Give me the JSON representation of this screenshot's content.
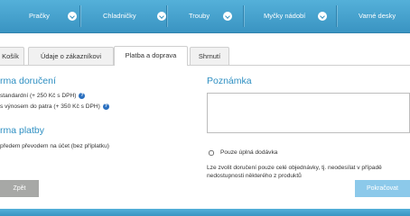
{
  "nav": {
    "items": [
      "Pračky",
      "Chladničky",
      "Trouby",
      "Myčky nádobí",
      "Varné desky"
    ]
  },
  "tabs": [
    "Košík",
    "Údaje o zákazníkovi",
    "Platba a doprava",
    "Shrnutí"
  ],
  "delivery": {
    "heading": "rma doručení",
    "options": [
      "standardní (+ 250 Kč s DPH)",
      "s výnosem do patra (+ 350 Kč s DPH)"
    ],
    "info_glyph": "?"
  },
  "payment": {
    "heading": "rma platby",
    "options": [
      "předem převodem na účet (bez příplatku)"
    ]
  },
  "note": {
    "heading": "Poznámka",
    "checkbox_label": "Pouze úplná dodávka",
    "hint_lines": [
      "Lze zvolit doručení pouze celé objednávky, tj. neodesílat v případě",
      "nedostupnosti některého z produktů"
    ]
  },
  "buttons": {
    "back": "Zpět",
    "next": "Pokračovat"
  },
  "colors": {
    "nav_bar": "#3a94c2",
    "heading": "#2e8fc2",
    "back_button": "#a7a8a6",
    "next_button": "#8cc9ea",
    "info_icon": "#2a6fbf"
  }
}
